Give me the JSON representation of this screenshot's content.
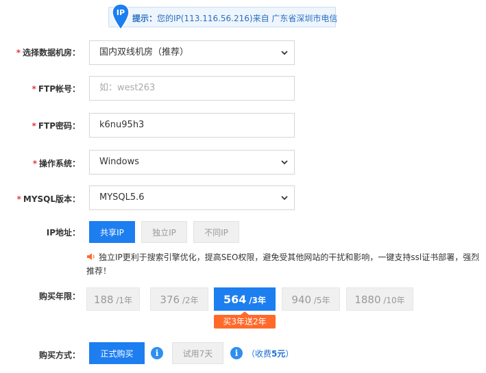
{
  "tip": {
    "pin_label": "IP",
    "lead": "提示：",
    "text": "您的IP(113.116.56.216)来自 广东省深圳市电信"
  },
  "form": {
    "datacenter": {
      "required": "*",
      "label": "选择数据机房：",
      "value": "国内双线机房（推荐）"
    },
    "ftp_account": {
      "required": "*",
      "label": "FTP帐号：",
      "placeholder": "如：west263"
    },
    "ftp_password": {
      "required": "*",
      "label": "FTP密码：",
      "value": "k6nu95h3"
    },
    "os": {
      "required": "*",
      "label": "操作系统：",
      "value": "Windows"
    },
    "mysql": {
      "required": "*",
      "label": "MYSQL版本：",
      "value": "MYSQL5.6"
    },
    "ip": {
      "label": "IP地址：",
      "options": [
        "共享IP",
        "独立IP",
        "不同IP"
      ],
      "selected": 0,
      "note_line1": "独立IP更利于搜索引擎优化，提高SEO权限，避免受其他网站的干扰和影响，一键支持ssl证书部署，强烈",
      "note_line2": "推荐！"
    },
    "years": {
      "label": "购买年限：",
      "options": [
        {
          "price": "188",
          "unit": "/1年"
        },
        {
          "price": "376",
          "unit": "/2年"
        },
        {
          "price": "564",
          "unit": "/3年"
        },
        {
          "price": "940",
          "unit": "/5年"
        },
        {
          "price": "1880",
          "unit": "/10年"
        }
      ],
      "selected": 2,
      "promo": "买3年送2年"
    },
    "purchase": {
      "label": "购买方式：",
      "formal": "正式购买",
      "trial": "试用7天",
      "fee_open": "（",
      "fee_text": "收费",
      "fee_amount": "5元",
      "fee_close": "）"
    }
  },
  "colors": {
    "accent": "#1d7ef0",
    "required": "#e4393c",
    "promo": "#ff6a2b",
    "tip_bg": "#eef5fd",
    "tip_text": "#2a6fbf"
  },
  "icons": [
    "location-pin-icon",
    "chevron-down-icon",
    "speaker-icon",
    "info-icon"
  ]
}
